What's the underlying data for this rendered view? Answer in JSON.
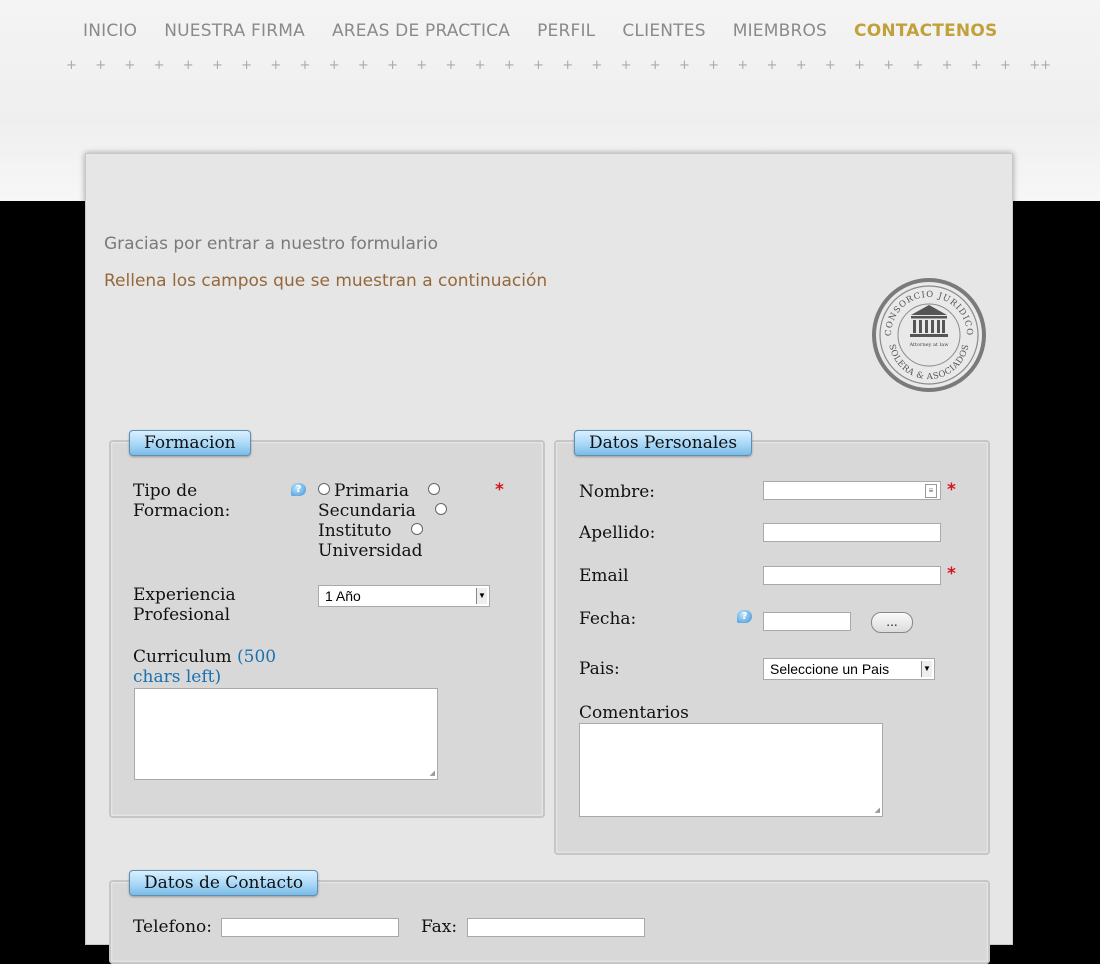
{
  "nav": {
    "items": [
      "INICIO",
      "NUESTRA FIRMA",
      "AREAS DE PRACTICA",
      "PERFIL",
      "CLIENTES",
      "MIEMBROS",
      "CONTACTENOS"
    ],
    "active_index": 6,
    "active_color": "#c2a13a"
  },
  "intro": {
    "line1": "Gracias por entrar a nuestro formulario",
    "line2": "Rellena los campos que se muestran a continuación"
  },
  "seal": {
    "top_text": "CONSORCIO JURIDICO",
    "middle_text": "Attorney at law",
    "bottom_text": "SOLERA & ASOCIADOS"
  },
  "formacion": {
    "legend": "Formacion",
    "tipo_label_1": "Tipo de",
    "tipo_label_2": "Formacion:",
    "options": [
      "Primaria",
      "Secundaria",
      "Instituto",
      "Universidad"
    ],
    "experiencia_label_1": "Experiencia",
    "experiencia_label_2": "Profesional",
    "experiencia_value": "1 Año",
    "curriculum_label": "Curriculum",
    "curriculum_counter_1": "(500",
    "curriculum_counter_2": "chars left)"
  },
  "datos_personales": {
    "legend": "Datos Personales",
    "nombre_label": "Nombre:",
    "apellido_label": "Apellido:",
    "email_label": "Email",
    "fecha_label": "Fecha:",
    "fecha_button": "...",
    "pais_label": "Pais:",
    "pais_value": "Seleccione un Pais",
    "comentarios_label": "Comentarios"
  },
  "datos_contacto": {
    "legend": "Datos de Contacto",
    "telefono_label": "Telefono:",
    "fax_label": "Fax:"
  },
  "required_mark": "*",
  "help_icon_glyph": "?"
}
